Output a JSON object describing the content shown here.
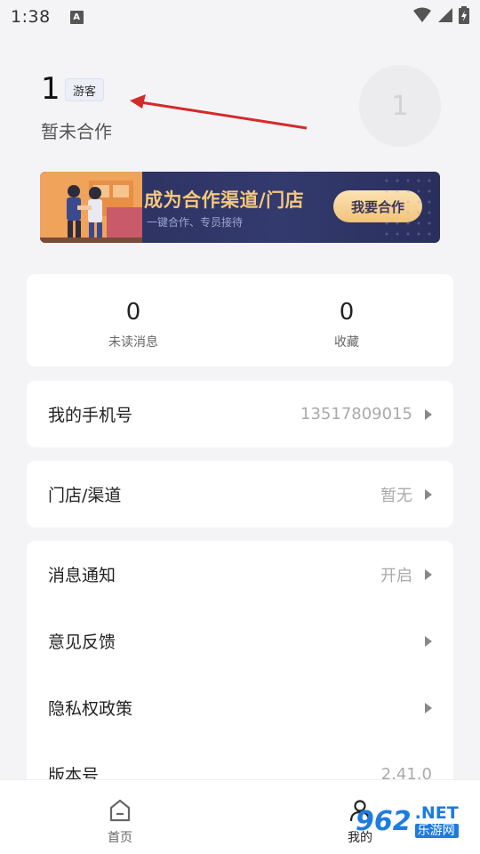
{
  "status_bar": {
    "time": "1:38",
    "a_icon": "A"
  },
  "profile": {
    "user_id": "1",
    "badge": "游客",
    "coop_status": "暂未合作",
    "avatar_text": "1"
  },
  "banner": {
    "title": "成为合作渠道/门店",
    "subtitle": "一键合作、专员接待",
    "button": "我要合作"
  },
  "stats": [
    {
      "value": "0",
      "label": "未读消息"
    },
    {
      "value": "0",
      "label": "收藏"
    }
  ],
  "phone_row": {
    "label": "我的手机号",
    "value": "13517809015"
  },
  "store_row": {
    "label": "门店/渠道",
    "value": "暂无"
  },
  "settings": [
    {
      "label": "消息通知",
      "value": "开启"
    },
    {
      "label": "意见反馈",
      "value": ""
    },
    {
      "label": "隐私权政策",
      "value": ""
    },
    {
      "label": "版本号",
      "value": "2.41.0"
    }
  ],
  "bottom_nav": [
    {
      "label": "首页",
      "icon": "home-icon"
    },
    {
      "label": "我的",
      "icon": "user-icon"
    }
  ],
  "watermark": {
    "logo": "962",
    "net": ".NET",
    "cn": "乐游网"
  },
  "colors": {
    "banner_bg": "#2b2f5b",
    "banner_title": "#f5c77e",
    "arrow": "#d42a2a",
    "watermark": "#1e7be0"
  }
}
